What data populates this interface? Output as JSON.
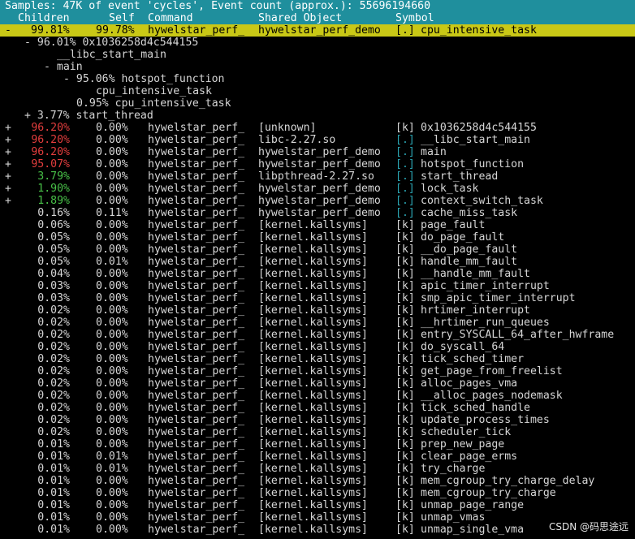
{
  "title_bar": "Samples: 47K of event 'cycles', Event count (approx.): 55696194660",
  "columns": {
    "children": "Children",
    "self": "Self",
    "command": "Command",
    "shared_object": "Shared Object",
    "symbol": "Symbol"
  },
  "selected_row": {
    "expander": "-",
    "children": "99.81%",
    "self": "99.78%",
    "command": "hywelstar_perf_",
    "shared_object": "hywelstar_perf_demo",
    "type": "[.]",
    "symbol": "cpu_intensive_task"
  },
  "call_tree": [
    "- 96.01% 0x1036258d4c544155",
    "__libc_start_main",
    "- main",
    "- 95.06% hotspot_function",
    "cpu_intensive_task",
    "0.95% cpu_intensive_task",
    "+ 3.77% start_thread"
  ],
  "rows": [
    {
      "expander": "+",
      "children": "96.20%",
      "children_color": "red",
      "self": "0.00%",
      "command": "hywelstar_perf_",
      "shared_object": "[unknown]",
      "type": "[k]",
      "type_color": "white",
      "symbol": "0x1036258d4c544155"
    },
    {
      "expander": "+",
      "children": "96.20%",
      "children_color": "red",
      "self": "0.00%",
      "command": "hywelstar_perf_",
      "shared_object": "libc-2.27.so",
      "type": "[.]",
      "type_color": "cyan",
      "symbol": "__libc_start_main"
    },
    {
      "expander": "+",
      "children": "96.20%",
      "children_color": "red",
      "self": "0.00%",
      "command": "hywelstar_perf_",
      "shared_object": "hywelstar_perf_demo",
      "type": "[.]",
      "type_color": "cyan",
      "symbol": "main"
    },
    {
      "expander": "+",
      "children": "95.07%",
      "children_color": "red",
      "self": "0.00%",
      "command": "hywelstar_perf_",
      "shared_object": "hywelstar_perf_demo",
      "type": "[.]",
      "type_color": "cyan",
      "symbol": "hotspot_function"
    },
    {
      "expander": "+",
      "children": "3.79%",
      "children_color": "green",
      "self": "0.00%",
      "command": "hywelstar_perf_",
      "shared_object": "libpthread-2.27.so",
      "type": "[.]",
      "type_color": "cyan",
      "symbol": "start_thread"
    },
    {
      "expander": "+",
      "children": "1.90%",
      "children_color": "green",
      "self": "0.00%",
      "command": "hywelstar_perf_",
      "shared_object": "hywelstar_perf_demo",
      "type": "[.]",
      "type_color": "cyan",
      "symbol": "lock_task"
    },
    {
      "expander": "+",
      "children": "1.89%",
      "children_color": "green",
      "self": "0.00%",
      "command": "hywelstar_perf_",
      "shared_object": "hywelstar_perf_demo",
      "type": "[.]",
      "type_color": "cyan",
      "symbol": "context_switch_task"
    },
    {
      "expander": "",
      "children": "0.16%",
      "children_color": "white",
      "self": "0.11%",
      "command": "hywelstar_perf_",
      "shared_object": "hywelstar_perf_demo",
      "type": "[.]",
      "type_color": "cyan",
      "symbol": "cache_miss_task"
    },
    {
      "expander": "",
      "children": "0.06%",
      "children_color": "white",
      "self": "0.00%",
      "command": "hywelstar_perf_",
      "shared_object": "[kernel.kallsyms]",
      "type": "[k]",
      "type_color": "white",
      "symbol": "page_fault"
    },
    {
      "expander": "",
      "children": "0.05%",
      "children_color": "white",
      "self": "0.00%",
      "command": "hywelstar_perf_",
      "shared_object": "[kernel.kallsyms]",
      "type": "[k]",
      "type_color": "white",
      "symbol": "do_page_fault"
    },
    {
      "expander": "",
      "children": "0.05%",
      "children_color": "white",
      "self": "0.00%",
      "command": "hywelstar_perf_",
      "shared_object": "[kernel.kallsyms]",
      "type": "[k]",
      "type_color": "white",
      "symbol": "__do_page_fault"
    },
    {
      "expander": "",
      "children": "0.05%",
      "children_color": "white",
      "self": "0.01%",
      "command": "hywelstar_perf_",
      "shared_object": "[kernel.kallsyms]",
      "type": "[k]",
      "type_color": "white",
      "symbol": "handle_mm_fault"
    },
    {
      "expander": "",
      "children": "0.04%",
      "children_color": "white",
      "self": "0.00%",
      "command": "hywelstar_perf_",
      "shared_object": "[kernel.kallsyms]",
      "type": "[k]",
      "type_color": "white",
      "symbol": "__handle_mm_fault"
    },
    {
      "expander": "",
      "children": "0.03%",
      "children_color": "white",
      "self": "0.00%",
      "command": "hywelstar_perf_",
      "shared_object": "[kernel.kallsyms]",
      "type": "[k]",
      "type_color": "white",
      "symbol": "apic_timer_interrupt"
    },
    {
      "expander": "",
      "children": "0.03%",
      "children_color": "white",
      "self": "0.00%",
      "command": "hywelstar_perf_",
      "shared_object": "[kernel.kallsyms]",
      "type": "[k]",
      "type_color": "white",
      "symbol": "smp_apic_timer_interrupt"
    },
    {
      "expander": "",
      "children": "0.02%",
      "children_color": "white",
      "self": "0.00%",
      "command": "hywelstar_perf_",
      "shared_object": "[kernel.kallsyms]",
      "type": "[k]",
      "type_color": "white",
      "symbol": "hrtimer_interrupt"
    },
    {
      "expander": "",
      "children": "0.02%",
      "children_color": "white",
      "self": "0.00%",
      "command": "hywelstar_perf_",
      "shared_object": "[kernel.kallsyms]",
      "type": "[k]",
      "type_color": "white",
      "symbol": "__hrtimer_run_queues"
    },
    {
      "expander": "",
      "children": "0.02%",
      "children_color": "white",
      "self": "0.00%",
      "command": "hywelstar_perf_",
      "shared_object": "[kernel.kallsyms]",
      "type": "[k]",
      "type_color": "white",
      "symbol": "entry_SYSCALL_64_after_hwframe"
    },
    {
      "expander": "",
      "children": "0.02%",
      "children_color": "white",
      "self": "0.00%",
      "command": "hywelstar_perf_",
      "shared_object": "[kernel.kallsyms]",
      "type": "[k]",
      "type_color": "white",
      "symbol": "do_syscall_64"
    },
    {
      "expander": "",
      "children": "0.02%",
      "children_color": "white",
      "self": "0.00%",
      "command": "hywelstar_perf_",
      "shared_object": "[kernel.kallsyms]",
      "type": "[k]",
      "type_color": "white",
      "symbol": "tick_sched_timer"
    },
    {
      "expander": "",
      "children": "0.02%",
      "children_color": "white",
      "self": "0.00%",
      "command": "hywelstar_perf_",
      "shared_object": "[kernel.kallsyms]",
      "type": "[k]",
      "type_color": "white",
      "symbol": "get_page_from_freelist"
    },
    {
      "expander": "",
      "children": "0.02%",
      "children_color": "white",
      "self": "0.00%",
      "command": "hywelstar_perf_",
      "shared_object": "[kernel.kallsyms]",
      "type": "[k]",
      "type_color": "white",
      "symbol": "alloc_pages_vma"
    },
    {
      "expander": "",
      "children": "0.02%",
      "children_color": "white",
      "self": "0.00%",
      "command": "hywelstar_perf_",
      "shared_object": "[kernel.kallsyms]",
      "type": "[k]",
      "type_color": "white",
      "symbol": "__alloc_pages_nodemask"
    },
    {
      "expander": "",
      "children": "0.02%",
      "children_color": "white",
      "self": "0.00%",
      "command": "hywelstar_perf_",
      "shared_object": "[kernel.kallsyms]",
      "type": "[k]",
      "type_color": "white",
      "symbol": "tick_sched_handle"
    },
    {
      "expander": "",
      "children": "0.02%",
      "children_color": "white",
      "self": "0.00%",
      "command": "hywelstar_perf_",
      "shared_object": "[kernel.kallsyms]",
      "type": "[k]",
      "type_color": "white",
      "symbol": "update_process_times"
    },
    {
      "expander": "",
      "children": "0.02%",
      "children_color": "white",
      "self": "0.00%",
      "command": "hywelstar_perf_",
      "shared_object": "[kernel.kallsyms]",
      "type": "[k]",
      "type_color": "white",
      "symbol": "scheduler_tick"
    },
    {
      "expander": "",
      "children": "0.01%",
      "children_color": "white",
      "self": "0.00%",
      "command": "hywelstar_perf_",
      "shared_object": "[kernel.kallsyms]",
      "type": "[k]",
      "type_color": "white",
      "symbol": "prep_new_page"
    },
    {
      "expander": "",
      "children": "0.01%",
      "children_color": "white",
      "self": "0.01%",
      "command": "hywelstar_perf_",
      "shared_object": "[kernel.kallsyms]",
      "type": "[k]",
      "type_color": "white",
      "symbol": "clear_page_erms"
    },
    {
      "expander": "",
      "children": "0.01%",
      "children_color": "white",
      "self": "0.01%",
      "command": "hywelstar_perf_",
      "shared_object": "[kernel.kallsyms]",
      "type": "[k]",
      "type_color": "white",
      "symbol": "try_charge"
    },
    {
      "expander": "",
      "children": "0.01%",
      "children_color": "white",
      "self": "0.00%",
      "command": "hywelstar_perf_",
      "shared_object": "[kernel.kallsyms]",
      "type": "[k]",
      "type_color": "white",
      "symbol": "mem_cgroup_try_charge_delay"
    },
    {
      "expander": "",
      "children": "0.01%",
      "children_color": "white",
      "self": "0.00%",
      "command": "hywelstar_perf_",
      "shared_object": "[kernel.kallsyms]",
      "type": "[k]",
      "type_color": "white",
      "symbol": "mem_cgroup_try_charge"
    },
    {
      "expander": "",
      "children": "0.01%",
      "children_color": "white",
      "self": "0.00%",
      "command": "hywelstar_perf_",
      "shared_object": "[kernel.kallsyms]",
      "type": "[k]",
      "type_color": "white",
      "symbol": "unmap_page_range"
    },
    {
      "expander": "",
      "children": "0.01%",
      "children_color": "white",
      "self": "0.00%",
      "command": "hywelstar_perf_",
      "shared_object": "[kernel.kallsyms]",
      "type": "[k]",
      "type_color": "white",
      "symbol": "unmap_vmas"
    },
    {
      "expander": "",
      "children": "0.01%",
      "children_color": "white",
      "self": "0.00%",
      "command": "hywelstar_perf_",
      "shared_object": "[kernel.kallsyms]",
      "type": "[k]",
      "type_color": "white",
      "symbol": "unmap_single_vma"
    }
  ],
  "watermark": "CSDN @码思途远",
  "colors": {
    "background": "#000000",
    "header": "#1f8f9d",
    "selection": "#c9c816",
    "high_percent": "#e23d3d",
    "mid_percent": "#48c048",
    "user_symbol_marker": "#2aa3b0"
  }
}
